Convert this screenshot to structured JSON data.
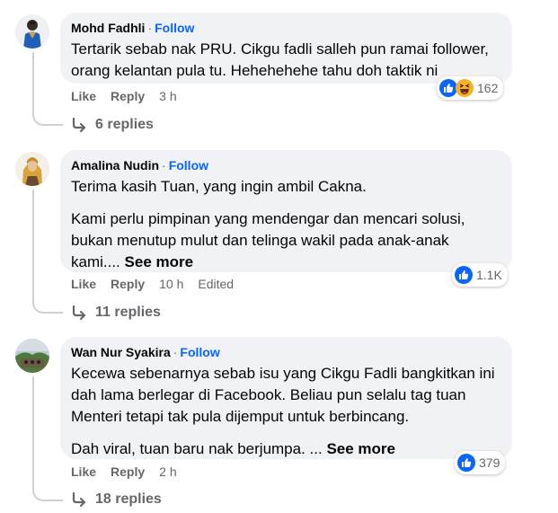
{
  "comments": [
    {
      "author": "Mohd Fadhli",
      "follow": "Follow",
      "separator": "·",
      "paragraphs": [
        "Tertarik sebab nak PRU. Cikgu fadli salleh pun ramai follower, orang kelantan pula tu. Hehehehehe tahu doh taktik ni"
      ],
      "see_more": "",
      "like": "Like",
      "reply": "Reply",
      "time": "3 h",
      "edited": "",
      "reaction_count": "162",
      "reaction_icons": [
        "like-icon",
        "haha-icon"
      ],
      "replies": "6 replies"
    },
    {
      "author": "Amalina Nudin",
      "follow": "Follow",
      "separator": "·",
      "paragraphs": [
        "Terima kasih Tuan, yang ingin ambil Cakna.",
        "Kami perlu pimpinan yang mendengar dan mencari solusi, bukan menutup mulut dan telinga wakil pada anak-anak kami...."
      ],
      "see_more": "See more",
      "like": "Like",
      "reply": "Reply",
      "time": "10 h",
      "edited": "Edited",
      "reaction_count": "1.1K",
      "reaction_icons": [
        "like-icon"
      ],
      "replies": "11 replies"
    },
    {
      "author": "Wan Nur Syakira",
      "follow": "Follow",
      "separator": "·",
      "paragraphs": [
        "Kecewa sebenarnya sebab isu yang Cikgu Fadli bangkitkan ini dah lama berlegar di Facebook. Beliau pun selalu tag tuan Menteri tetapi tak pula dijemput untuk berbincang.",
        "Dah viral, tuan baru nak berjumpa. ..."
      ],
      "see_more": "See more",
      "like": "Like",
      "reply": "Reply",
      "time": "2 h",
      "edited": "",
      "reaction_count": "379",
      "reaction_icons": [
        "like-icon"
      ],
      "replies": "18 replies"
    }
  ],
  "colors": {
    "bubble": "#f0f2f5",
    "follow": "#0866ff",
    "muted": "#65676b",
    "like_blue": "#0866ff",
    "haha_yellow": "#f7b125"
  }
}
